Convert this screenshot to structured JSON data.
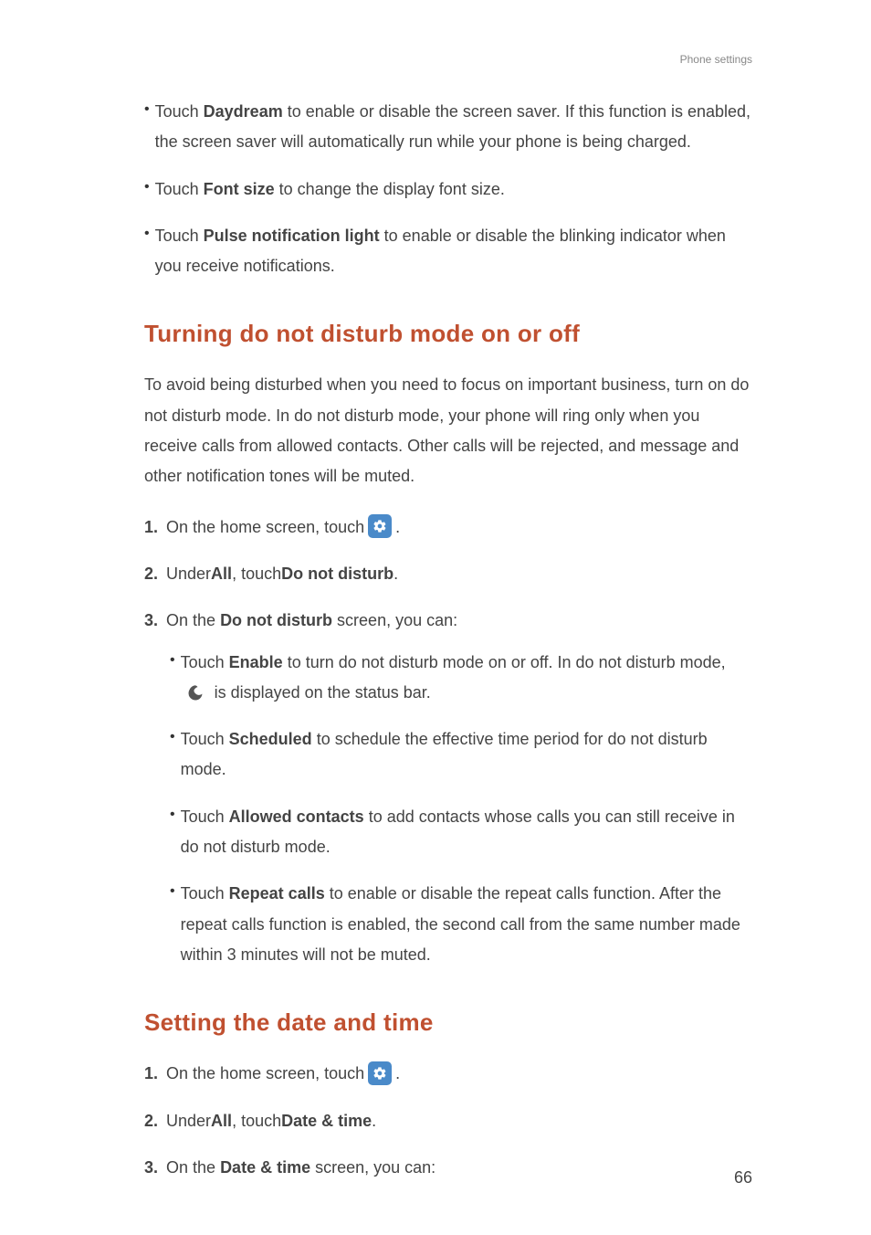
{
  "header": {
    "sectionLabel": "Phone settings"
  },
  "topBullets": [
    {
      "pre": "Touch ",
      "bold": "Daydream",
      "post": " to enable or disable the screen saver. If this function is enabled, the screen saver will automatically run while your phone is being charged."
    },
    {
      "pre": "Touch ",
      "bold": "Font size",
      "post": " to change the display font size."
    },
    {
      "pre": "Touch ",
      "bold": "Pulse notification light",
      "post": " to enable or disable the blinking indicator when you receive notifications."
    }
  ],
  "heading1": "Turning do not disturb mode on or off",
  "para1": "To avoid being disturbed when you need to focus on important business, turn on do not disturb mode. In do not disturb mode, your phone will ring only when you receive calls from allowed contacts. Other calls will be rejected, and message and other notification tones will be muted.",
  "numbered1": {
    "n1": {
      "num": "1.",
      "pre": "On the home screen, touch ",
      "post": "."
    },
    "n2": {
      "num": "2.",
      "pre": "Under ",
      "bold1": "All",
      "mid": ", touch ",
      "bold2": "Do not disturb",
      "post": "."
    },
    "n3": {
      "num": "3.",
      "pre": "On the ",
      "bold": "Do not disturb",
      "post": " screen, you can:"
    }
  },
  "nestedBullets": [
    {
      "pre": "Touch ",
      "bold": "Enable",
      "mid1": " to turn do not disturb mode on or off. In do not disturb mode, ",
      "mid2": " is displayed on the status bar.",
      "hasMoon": true
    },
    {
      "pre": "Touch ",
      "bold": "Scheduled",
      "post": " to schedule the effective time period for do not disturb mode."
    },
    {
      "pre": "Touch ",
      "bold": "Allowed contacts",
      "post": " to add contacts whose calls you can still receive in do not disturb mode."
    },
    {
      "pre": "Touch ",
      "bold": "Repeat calls",
      "post": " to enable or disable the repeat calls function. After the repeat calls function is enabled, the second call from the same number made within 3 minutes will not be muted."
    }
  ],
  "heading2": "Setting the date and time",
  "numbered2": {
    "n1": {
      "num": "1.",
      "pre": "On the home screen, touch ",
      "post": "."
    },
    "n2": {
      "num": "2.",
      "pre": "Under ",
      "bold1": "All",
      "mid": ", touch ",
      "bold2": "Date & time",
      "post": "."
    },
    "n3": {
      "num": "3.",
      "pre": "On the ",
      "bold": "Date & time",
      "post": " screen, you can:"
    }
  },
  "pageNumber": "66"
}
